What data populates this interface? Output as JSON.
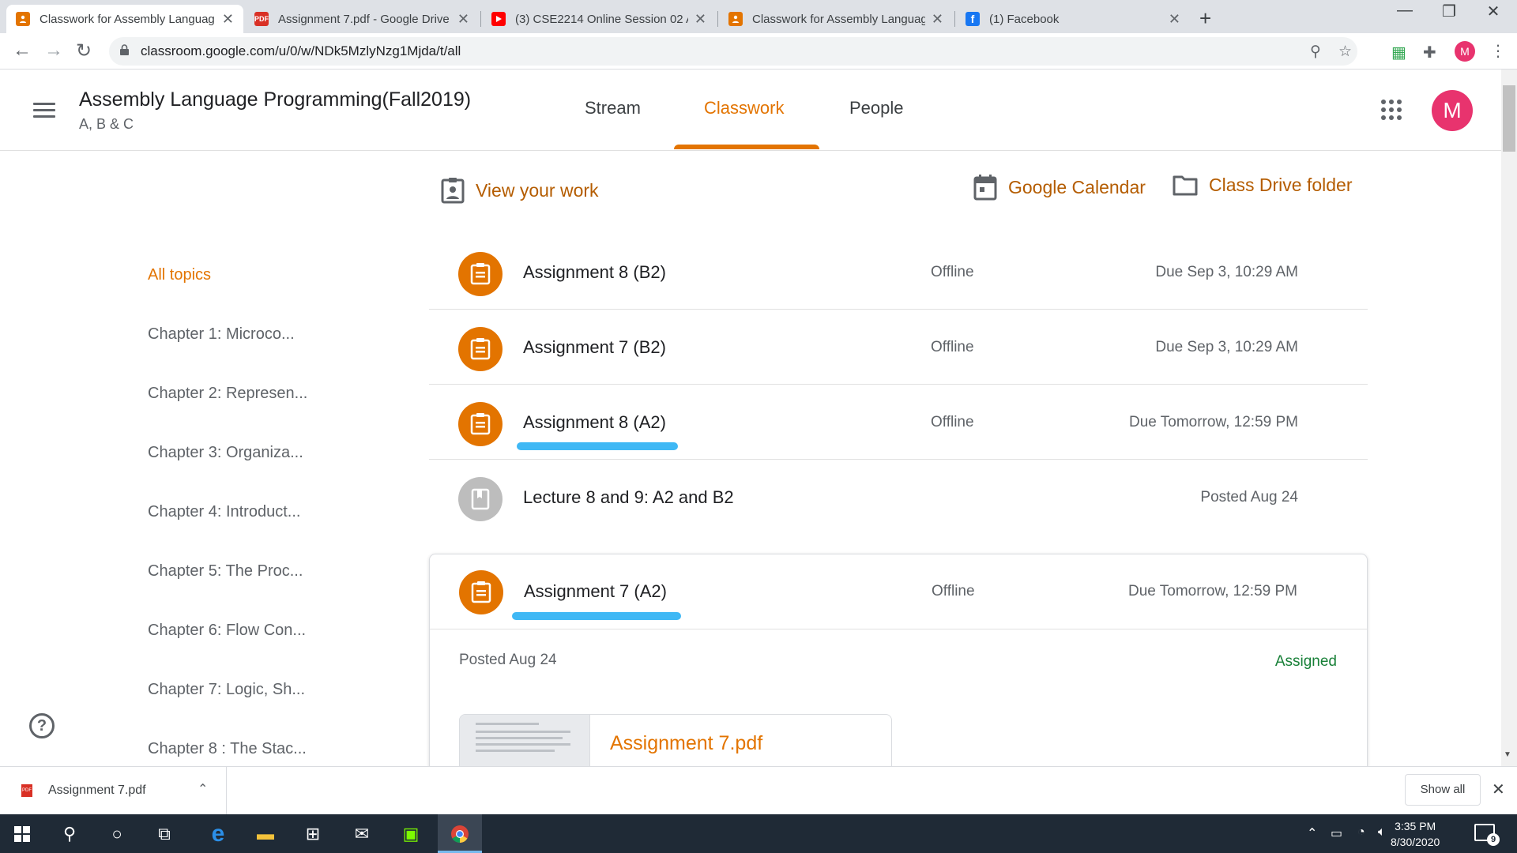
{
  "browser": {
    "tabs": [
      {
        "title": "Classwork for Assembly Languag",
        "active": true,
        "favicon": "classroom-icon",
        "favicon_color": "#e37400"
      },
      {
        "title": "Assignment 7.pdf - Google Drive",
        "active": false,
        "favicon": "pdf-icon",
        "favicon_color": "#d93025",
        "favicon_text": "PDF"
      },
      {
        "title": "(3) CSE2214 Online Session 02 A",
        "active": false,
        "favicon": "youtube-icon",
        "favicon_color": "#ff0000"
      },
      {
        "title": "Classwork for Assembly Languag",
        "active": false,
        "favicon": "classroom-icon",
        "favicon_color": "#e37400"
      },
      {
        "title": "(1) Facebook",
        "active": false,
        "favicon": "facebook-icon",
        "favicon_color": "#1877f2",
        "favicon_text": "f"
      }
    ],
    "url": "classroom.google.com/u/0/w/NDk5MzlyNzg1Mjda/t/all",
    "profile_initial": "M"
  },
  "classroom": {
    "course_title": "Assembly Language Programming(Fall2019)",
    "section": "A, B & C",
    "nav_tabs": [
      {
        "label": "Stream",
        "active": false
      },
      {
        "label": "Classwork",
        "active": true
      },
      {
        "label": "People",
        "active": false
      }
    ],
    "avatar_initial": "M",
    "view_work": "View your work",
    "google_calendar": "Google Calendar",
    "drive_folder": "Class Drive folder",
    "topics": [
      "All topics",
      "Chapter 1: Microco...",
      "Chapter 2: Represen...",
      "Chapter 3: Organiza...",
      "Chapter 4: Introduct...",
      "Chapter 5: The Proc...",
      "Chapter 6: Flow Con...",
      "Chapter 7: Logic, Sh...",
      "Chapter 8 : The Stac..."
    ],
    "items": [
      {
        "title": "Assignment 8 (B2)",
        "status": "Offline",
        "due": "Due Sep 3, 10:29 AM",
        "type": "assignment"
      },
      {
        "title": "Assignment 7 (B2)",
        "status": "Offline",
        "due": "Due Sep 3, 10:29 AM",
        "type": "assignment"
      },
      {
        "title": "Assignment 8 (A2)",
        "status": "Offline",
        "due": "Due Tomorrow, 12:59 PM",
        "type": "assignment",
        "highlighted": true
      },
      {
        "title": "Lecture 8 and 9: A2 and B2",
        "status": "",
        "due": "Posted Aug 24",
        "type": "material"
      }
    ],
    "expanded_item": {
      "title": "Assignment 7 (A2)",
      "status": "Offline",
      "due": "Due Tomorrow, 12:59 PM",
      "posted": "Posted Aug 24",
      "state": "Assigned",
      "attachment": {
        "name": "Assignment 7.pdf",
        "type": "PDF"
      }
    },
    "colors": {
      "accent": "#e37400",
      "assigned": "#188038",
      "highlight": "#3fb8f5"
    }
  },
  "downloads": {
    "file": "Assignment 7.pdf",
    "show_all": "Show all"
  },
  "taskbar": {
    "time": "3:35 PM",
    "date": "8/30/2020",
    "notifications": "9"
  }
}
